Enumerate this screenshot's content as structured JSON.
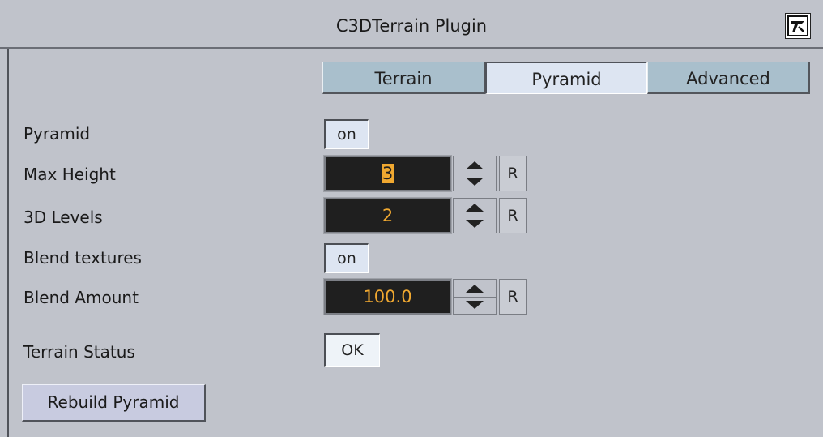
{
  "window": {
    "title": "C3DTerrain Plugin",
    "icon": "plugin-logo-icon"
  },
  "tabs": [
    {
      "label": "Terrain",
      "active": false
    },
    {
      "label": "Pyramid",
      "active": true
    },
    {
      "label": "Advanced",
      "active": false
    }
  ],
  "fields": {
    "pyramid": {
      "label": "Pyramid",
      "value": "on"
    },
    "max_height": {
      "label": "Max Height",
      "value": "3",
      "reset_label": "R"
    },
    "levels_3d": {
      "label": "3D Levels",
      "value": "2",
      "reset_label": "R"
    },
    "blend_textures": {
      "label": "Blend textures",
      "value": "on"
    },
    "blend_amount": {
      "label": "Blend Amount",
      "value": "100.0",
      "reset_label": "R"
    },
    "terrain_status": {
      "label": "Terrain Status",
      "value": "OK"
    }
  },
  "actions": {
    "rebuild_label": "Rebuild Pyramid"
  },
  "colors": {
    "background": "#c0c3cb",
    "field_bg": "#1f1f1f",
    "field_text": "#f0a830",
    "tab_inactive": "#a9bfcc",
    "tab_active": "#dde5f2"
  }
}
